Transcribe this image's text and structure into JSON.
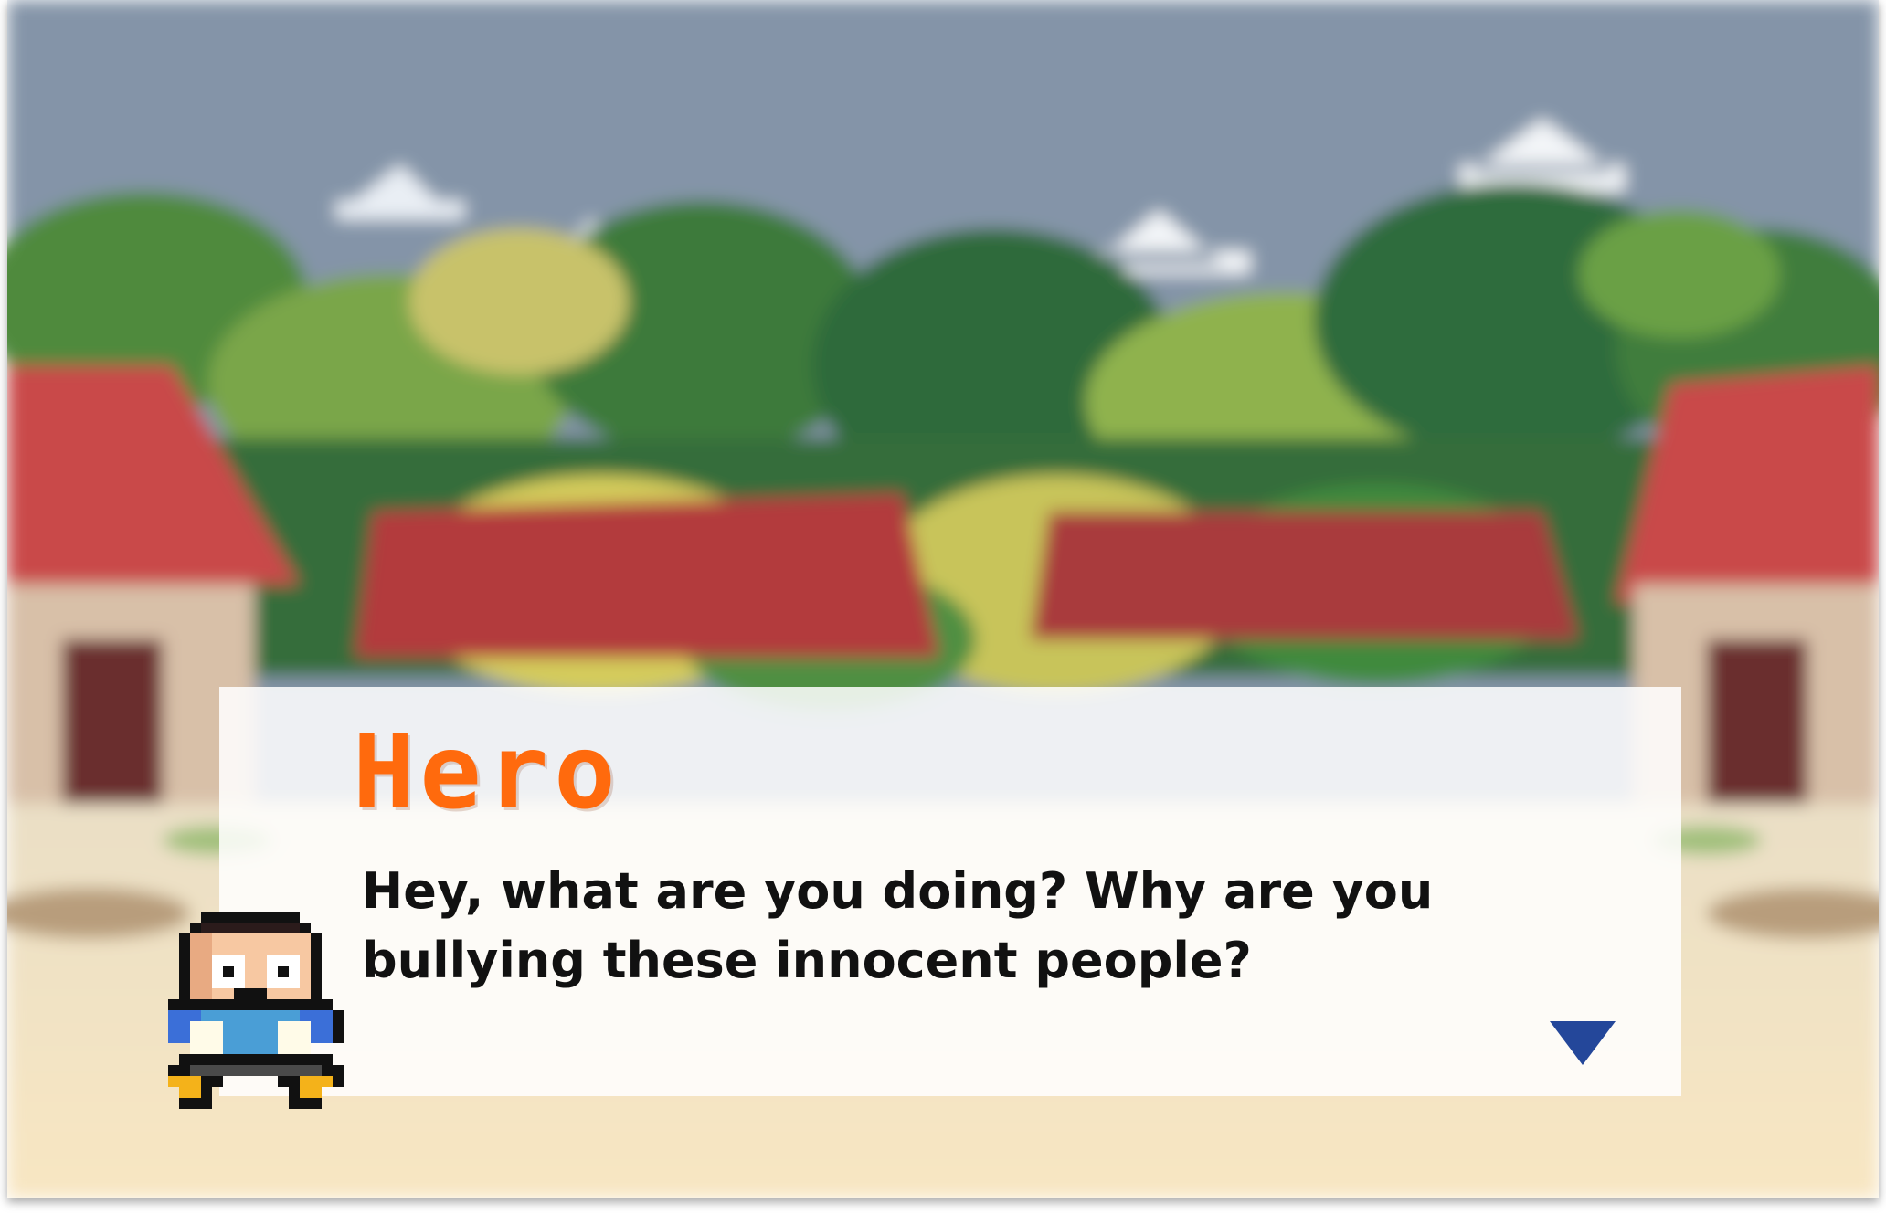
{
  "dialog": {
    "speaker": "Hero",
    "text": "Hey, what are you doing? Why are you bullying these innocent people?",
    "continue_icon": "triangle-down-icon"
  },
  "portrait": {
    "icon": "hero-pixel-portrait-icon"
  },
  "colors": {
    "sky": "#8494a8",
    "speaker_name": "#ff6a0d",
    "dialog_text": "#111111",
    "continue_arrow": "#24479a",
    "panel": "#ffffff",
    "ground": "#f6e6c4"
  }
}
